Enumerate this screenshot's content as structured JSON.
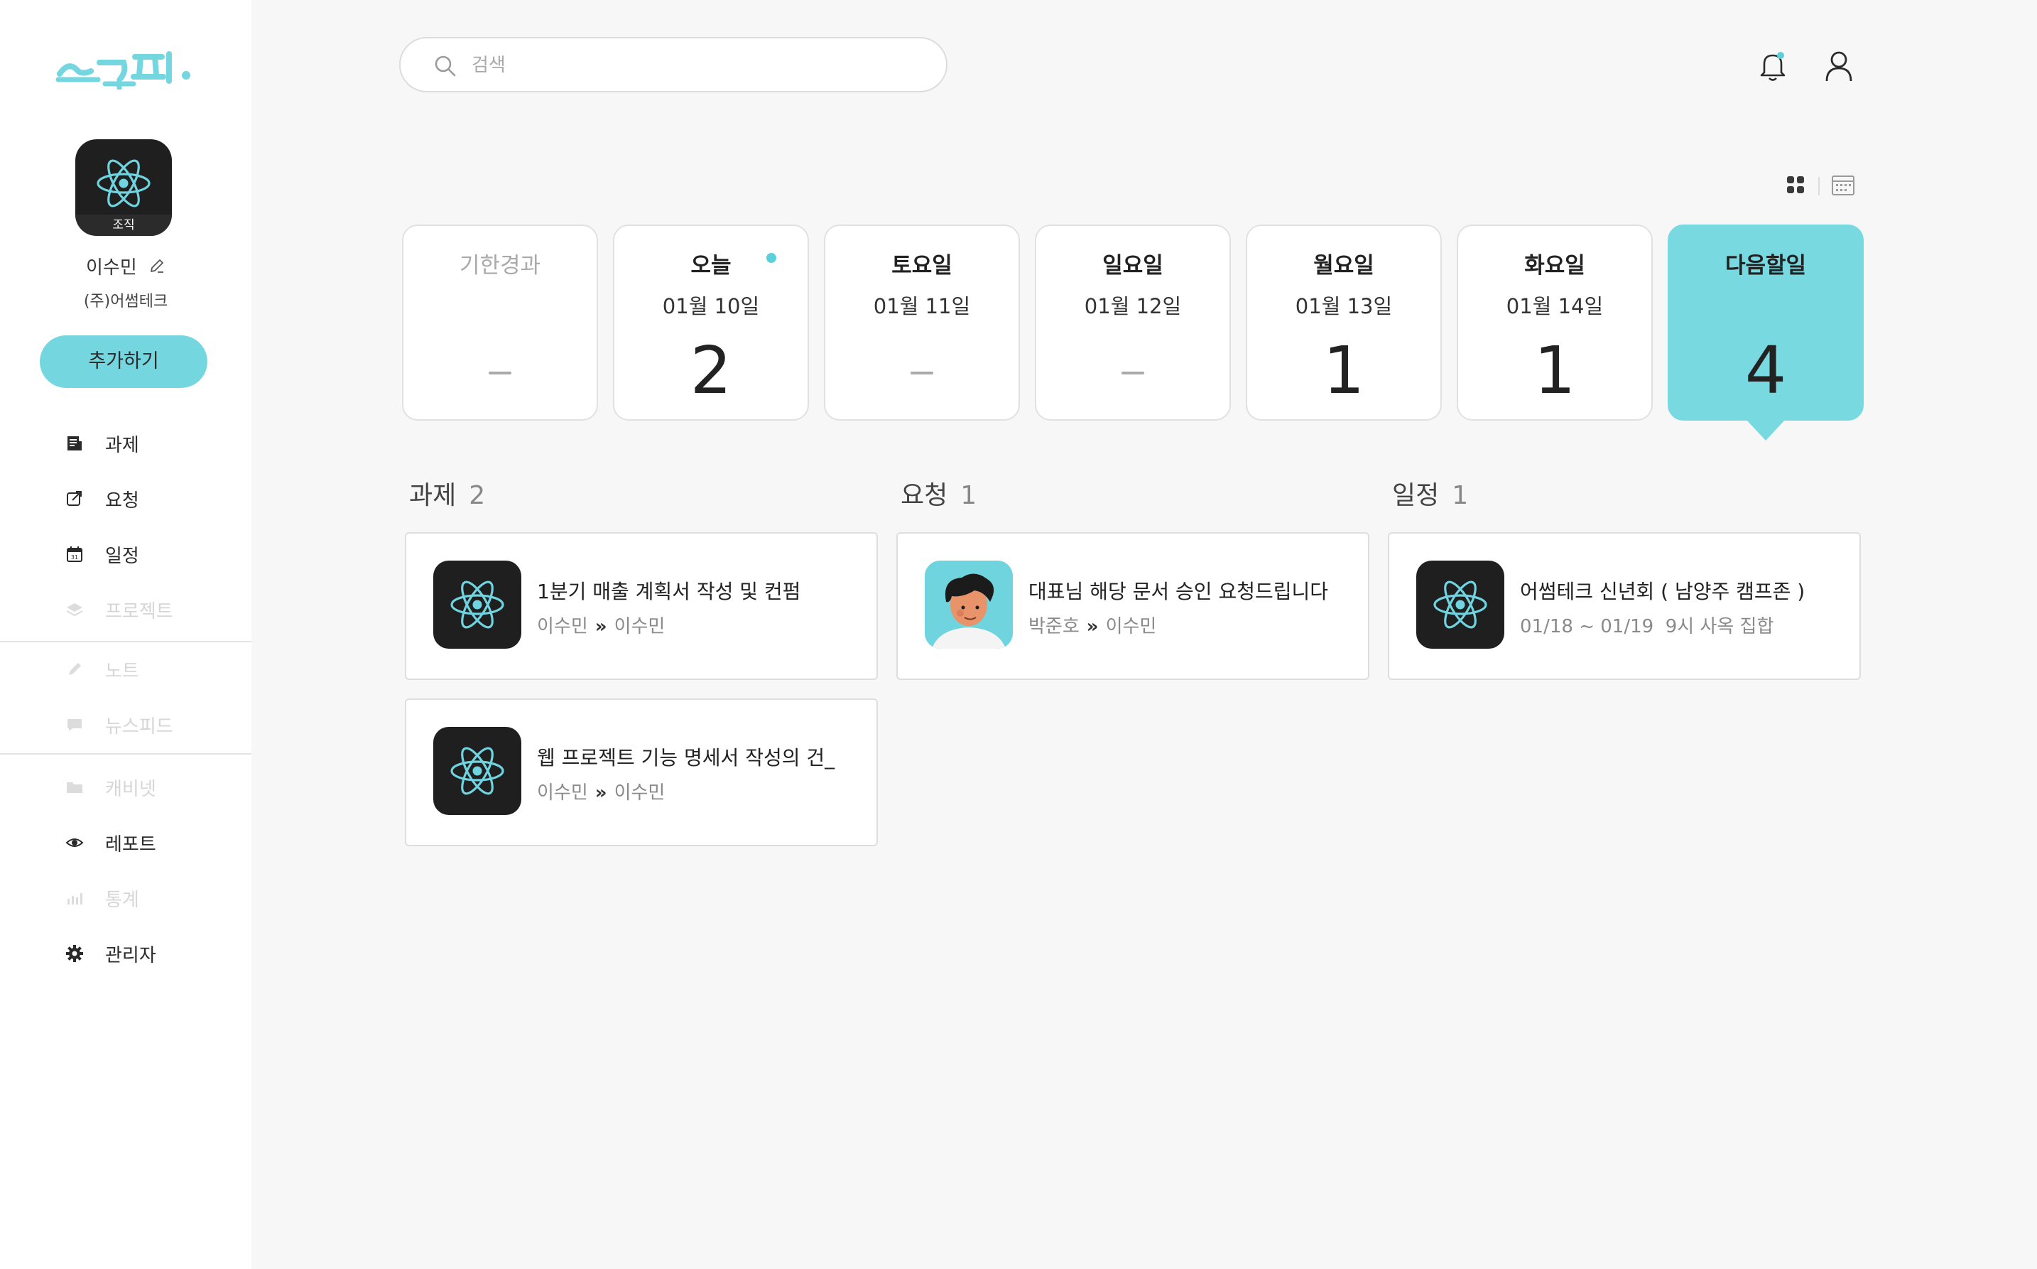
{
  "brand": {
    "logo_text": "스누피.",
    "accent": "#74d7e0"
  },
  "profile": {
    "org_tag": "조직",
    "name": "이수민",
    "company": "(주)어썸테크",
    "add_button": "추가하기"
  },
  "nav": {
    "tasks": "과제",
    "requests": "요청",
    "schedule": "일정",
    "projects": "프로젝트",
    "notes": "노트",
    "newsfeed": "뉴스피드",
    "cabinet": "캐비넷",
    "report": "레포트",
    "stats": "통계",
    "admin": "관리자"
  },
  "search": {
    "placeholder": "검색"
  },
  "days": [
    {
      "name": "기한경과",
      "date": "",
      "count": "",
      "state": "muted"
    },
    {
      "name": "오늘",
      "date": "01월 10일",
      "count": "2",
      "state": "today"
    },
    {
      "name": "토요일",
      "date": "01월 11일",
      "count": "",
      "state": "empty"
    },
    {
      "name": "일요일",
      "date": "01월 12일",
      "count": "",
      "state": "empty"
    },
    {
      "name": "월요일",
      "date": "01월 13일",
      "count": "1",
      "state": "normal"
    },
    {
      "name": "화요일",
      "date": "01월 14일",
      "count": "1",
      "state": "normal"
    },
    {
      "name": "다음할일",
      "date": "",
      "count": "4",
      "state": "active"
    }
  ],
  "sections": {
    "tasks": {
      "label": "과제",
      "count": "2"
    },
    "requests": {
      "label": "요청",
      "count": "1"
    },
    "schedule": {
      "label": "일정",
      "count": "1"
    }
  },
  "cards": {
    "task1": {
      "title": "1분기 매출 계획서 작성 및 컨펌",
      "from": "이수민",
      "arrow": "»",
      "to": "이수민"
    },
    "task2": {
      "title": "웹 프로젝트 기능 명세서 작성의 건_",
      "from": "이수민",
      "arrow": "»",
      "to": "이수민"
    },
    "request1": {
      "title": "대표님 해당 문서 승인 요청드립니다",
      "from": "박준호",
      "arrow": "»",
      "to": "이수민"
    },
    "event1": {
      "title": "어썸테크 신년회 ( 남양주 캠프존 )",
      "range": "01/18 ~ 01/19",
      "note": "9시 사옥 집합"
    }
  }
}
